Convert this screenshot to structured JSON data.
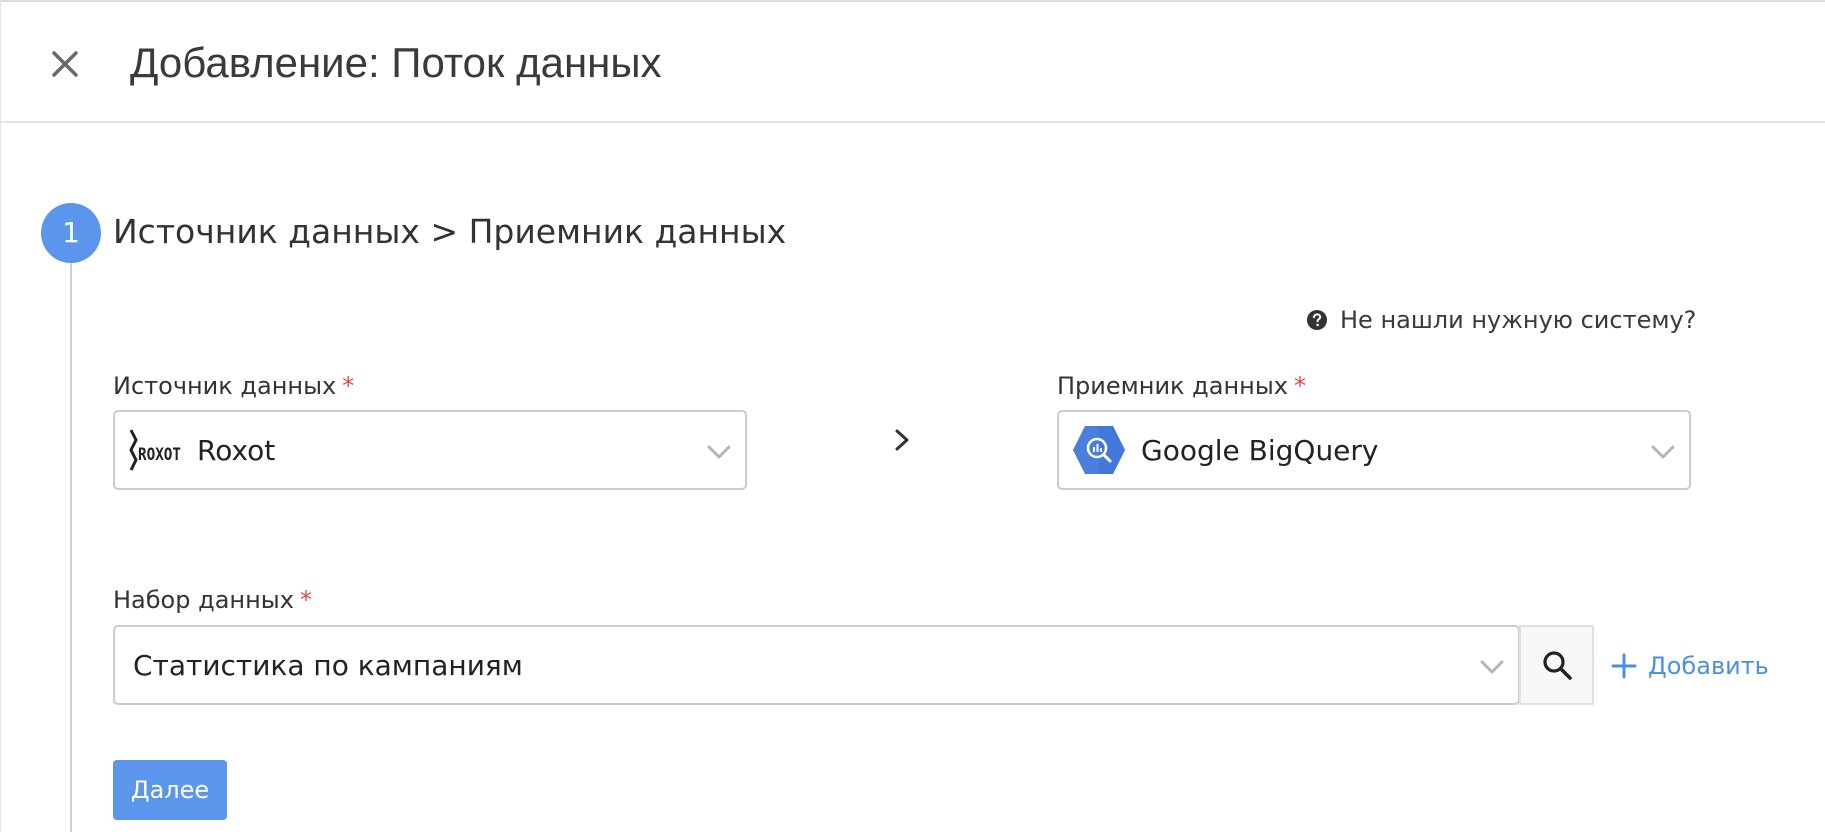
{
  "header": {
    "title": "Добавление: Поток данных"
  },
  "step": {
    "number": "1",
    "title": "Источник данных > Приемник данных"
  },
  "help": {
    "text": "Не нашли нужную систему?"
  },
  "source": {
    "label": "Источник данных",
    "required_mark": "*",
    "value": "Roxot",
    "logo_text": "ROXOT"
  },
  "destination": {
    "label": "Приемник данных",
    "required_mark": "*",
    "value": "Google BigQuery"
  },
  "dataset": {
    "label": "Набор данных",
    "required_mark": "*",
    "value": "Статистика по кампаниям"
  },
  "actions": {
    "add_label": "Добавить",
    "next_label": "Далее"
  },
  "colors": {
    "accent": "#5b95ec",
    "link": "#4a90e2",
    "required": "#e04a4a",
    "bigquery": "#4a7fe0"
  },
  "icons": {
    "close": "close-icon",
    "help": "question-circle-icon",
    "chevron": "chevron-down-icon",
    "separator": "chevron-right-icon",
    "search": "search-icon",
    "add": "plus-icon"
  }
}
